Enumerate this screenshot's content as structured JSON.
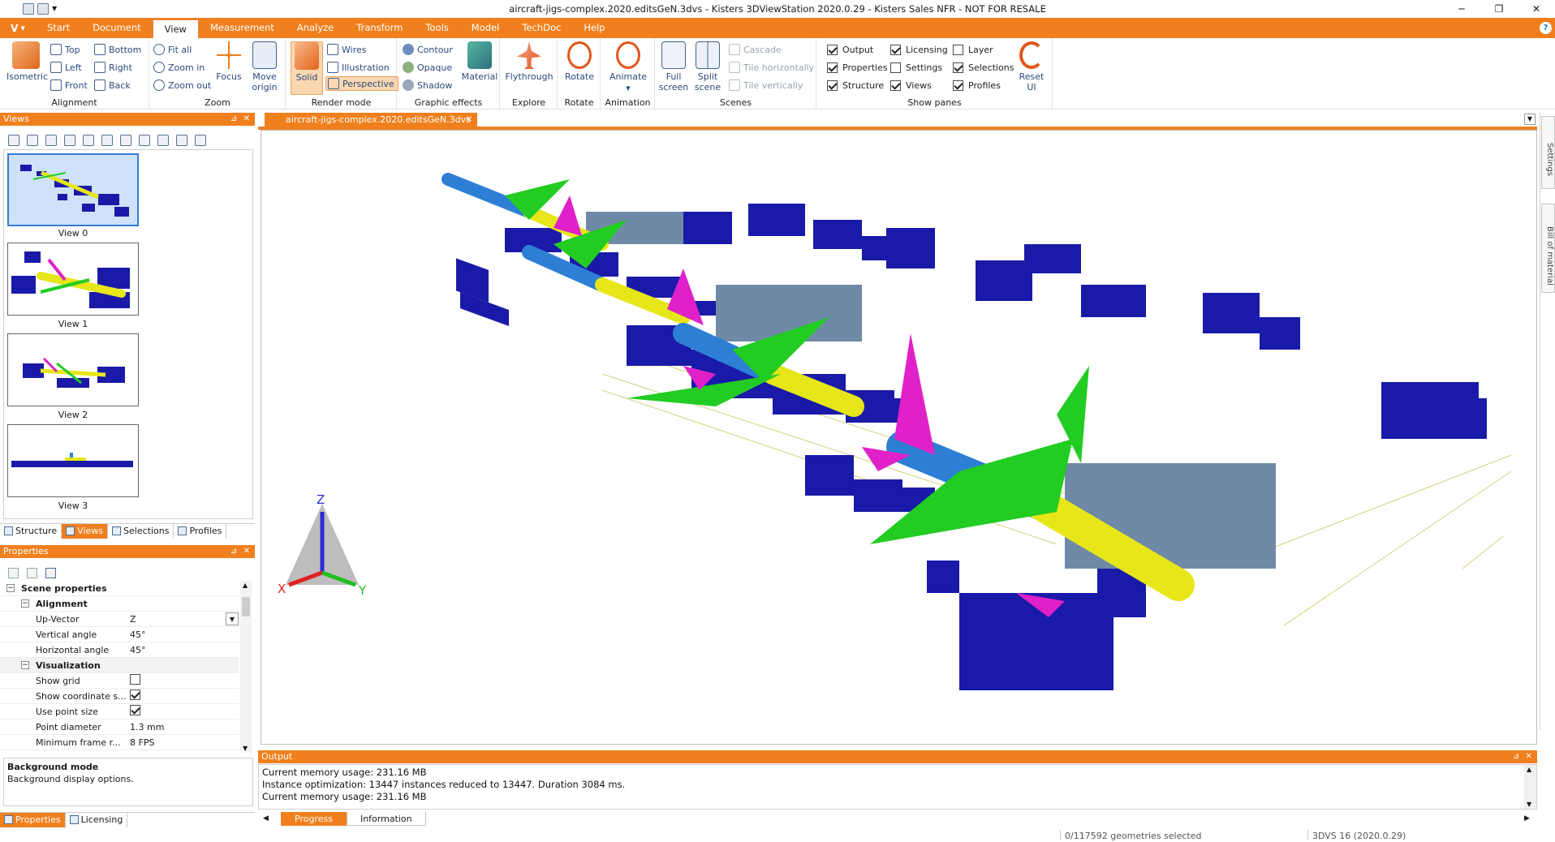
{
  "window": {
    "title": "aircraft-jigs-complex.2020.editsGeN.3dvs - Kisters 3DViewStation 2020.0.29 - Kisters Sales NFR - NOT FOR RESALE",
    "controls": [
      "─",
      "❐",
      "✕"
    ]
  },
  "menu": {
    "logo": "V",
    "tabs": [
      "Start",
      "Document",
      "View",
      "Measurement",
      "Analyze",
      "Transform",
      "Tools",
      "Model",
      "TechDoc",
      "Help"
    ],
    "active": "View",
    "help": "?"
  },
  "ribbon": {
    "alignment": {
      "name": "Alignment",
      "isometric": "Isometric",
      "top": "Top",
      "bottom": "Bottom",
      "left": "Left",
      "right": "Right",
      "front": "Front",
      "back": "Back"
    },
    "zoom": {
      "name": "Zoom",
      "fit_all": "Fit all",
      "zoom_in": "Zoom in",
      "zoom_out": "Zoom out",
      "focus": "Focus",
      "move_origin_1": "Move",
      "move_origin_2": "origin"
    },
    "render": {
      "name": "Render mode",
      "solid": "Solid",
      "wires": "Wires",
      "illustration": "Illustration",
      "perspective": "Perspective"
    },
    "effects": {
      "name": "Graphic effects",
      "contour": "Contour",
      "opaque": "Opaque",
      "shadow": "Shadow",
      "material": "Material"
    },
    "explore": {
      "name": "Explore",
      "flythrough": "Flythrough"
    },
    "rotate": {
      "name": "Rotate",
      "rotate": "Rotate"
    },
    "animation": {
      "name": "Animation",
      "animate": "Animate"
    },
    "scenes": {
      "name": "Scenes",
      "full_1": "Full",
      "full_2": "screen",
      "split_1": "Split",
      "split_2": "scene",
      "cascade": "Cascade",
      "tile_h": "Tile horizontally",
      "tile_v": "Tile vertically"
    },
    "panes": {
      "name": "Show panes",
      "output": "Output",
      "properties": "Properties",
      "structure": "Structure",
      "licensing": "Licensing",
      "settings": "Settings",
      "views": "Views",
      "layer": "Layer",
      "selections": "Selections",
      "profiles": "Profiles",
      "reset_1": "Reset",
      "reset_2": "UI"
    }
  },
  "views_pane": {
    "title": "Views",
    "pin": "⊿",
    "close": "✕",
    "items": [
      {
        "label": "View 0"
      },
      {
        "label": "View 1"
      },
      {
        "label": "View 2"
      },
      {
        "label": "View 3"
      }
    ],
    "tabs": [
      "Structure",
      "Views",
      "Selections",
      "Profiles"
    ],
    "active_tab": "Views"
  },
  "properties_pane": {
    "title": "Properties",
    "pin": "⊿",
    "close": "✕",
    "scene_properties": "Scene properties",
    "alignment": "Alignment",
    "up_vector": {
      "key": "Up-Vector",
      "value": "Z"
    },
    "vertical_angle": {
      "key": "Vertical angle",
      "value": "45°"
    },
    "horizontal_angle": {
      "key": "Horizontal angle",
      "value": "45°"
    },
    "visualization": "Visualization",
    "show_grid": {
      "key": "Show grid",
      "checked": false
    },
    "show_coord": {
      "key": "Show coordinate s...",
      "checked": true
    },
    "use_point_size": {
      "key": "Use point size",
      "checked": true
    },
    "point_diameter": {
      "key": "Point diameter",
      "value": "1.3 mm"
    },
    "min_frame_rate": {
      "key": "Minimum frame r...",
      "value": "8 FPS"
    },
    "desc_title": "Background mode",
    "desc_text": "Background display options.",
    "tabs": [
      "Properties",
      "Licensing"
    ],
    "active_tab": "Properties"
  },
  "document": {
    "tab": "aircraft-jigs-complex.2020.editsGeN.3dvs",
    "close": "✕",
    "axes": {
      "x": "X",
      "y": "Y",
      "z": "Z"
    }
  },
  "right_sidebar": {
    "settings": "Settings",
    "bom": "Bill of material"
  },
  "output": {
    "title": "Output",
    "pin": "⊿",
    "close": "✕",
    "lines": [
      "Current memory usage: 231.16 MB",
      "Instance optimization: 13447 instances reduced to 13447. Duration 3084 ms.",
      "Current memory usage: 231.16 MB"
    ],
    "tabs": [
      "Progress",
      "Information"
    ],
    "active_tab": "Progress"
  },
  "status": {
    "selection": "0/117592 geometries selected",
    "version": "3DVS 16 (2020.0.29)"
  },
  "colors": {
    "accent": "#f0801e",
    "jig": "#1a1aa8",
    "fuselage": "#e6e619",
    "wing": "#22cc22",
    "tail": "#e020c8",
    "body": "#2d7fd6"
  }
}
